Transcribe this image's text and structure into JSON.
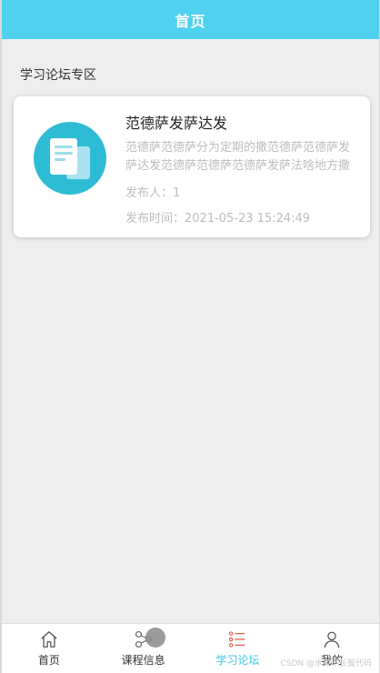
{
  "header": {
    "title": "首页"
  },
  "section": {
    "title": "学习论坛专区"
  },
  "posts": [
    {
      "title": "范德萨发萨达发",
      "description": "范德萨范德萨分为定期的撒范德萨范德萨发萨达发范德萨范德萨范德萨发萨法啥地方撒",
      "author": "发布人：1",
      "time": "发布时间：2021-05-23 15:24:49",
      "icon": "document-icon"
    }
  ],
  "tabbar": {
    "items": [
      {
        "label": "首页",
        "icon": "home-icon",
        "active": false
      },
      {
        "label": "课程信息",
        "icon": "share-icon",
        "active": false
      },
      {
        "label": "学习论坛",
        "icon": "list-icon",
        "active": true
      },
      {
        "label": "我的",
        "icon": "user-icon",
        "active": false
      }
    ]
  },
  "watermark": "CSDN @水果不长鬓代码",
  "colors": {
    "accent": "#4fd1ef",
    "icon_bg": "#2ebcd5",
    "active_tab": "#39c6e8"
  }
}
